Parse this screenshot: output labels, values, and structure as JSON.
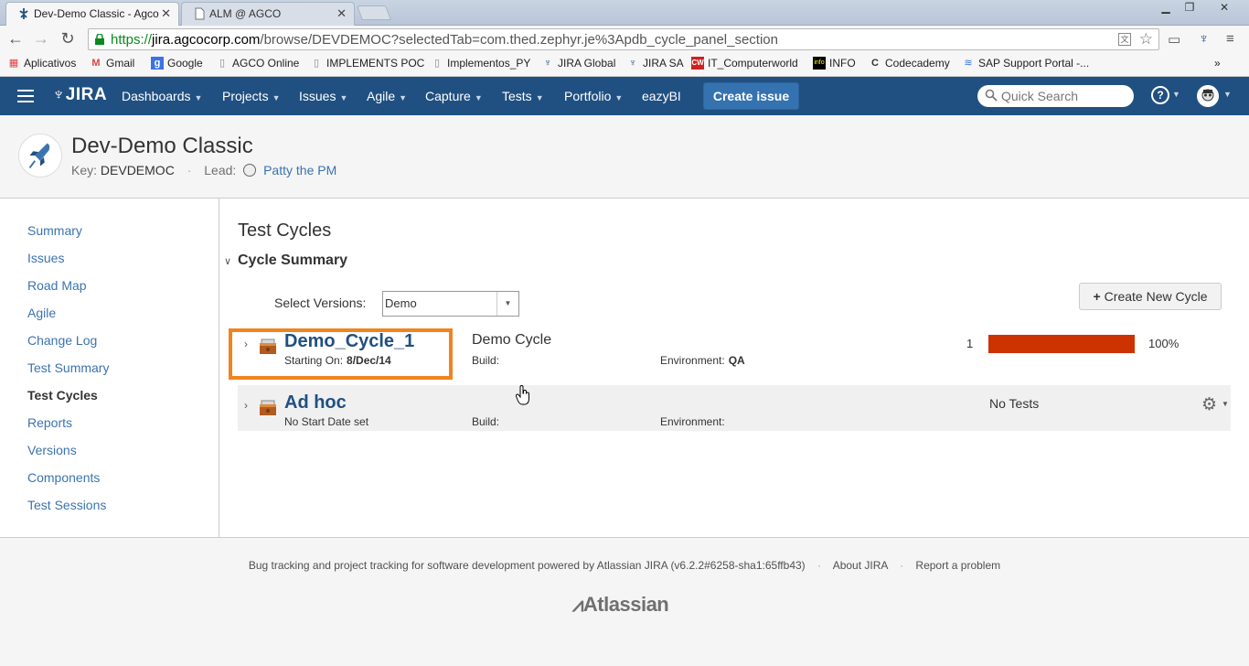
{
  "browser": {
    "tabs": [
      {
        "title": "Dev-Demo Classic - Agco",
        "active": true
      },
      {
        "title": "ALM @ AGCO",
        "active": false
      }
    ],
    "url": {
      "scheme": "https://",
      "host": "jira.agcocorp.com",
      "path": "/browse/DEVDEMOC?selectedTab=com.thed.zephyr.je%3Apdb_cycle_panel_section"
    },
    "bookmarks": [
      "Aplicativos",
      "Gmail",
      "Google",
      "AGCO Online",
      "IMPLEMENTS POC",
      "Implementos_PY",
      "JIRA Global",
      "JIRA SA",
      "IT_Computerworld",
      "INFO",
      "Codecademy",
      "SAP Support Portal -..."
    ]
  },
  "jira_header": {
    "logo": "JIRA",
    "nav": [
      "Dashboards",
      "Projects",
      "Issues",
      "Agile",
      "Capture",
      "Tests",
      "Portfolio",
      "eazyBI"
    ],
    "create_issue": "Create issue",
    "search_placeholder": "Quick Search",
    "help": "?"
  },
  "project": {
    "name": "Dev-Demo Classic",
    "key_label": "Key:",
    "key": "DEVDEMOC",
    "lead_label": "Lead:",
    "lead": "Patty the PM"
  },
  "sidebar": {
    "items": [
      "Summary",
      "Issues",
      "Road Map",
      "Agile",
      "Change Log",
      "Test Summary",
      "Test Cycles",
      "Reports",
      "Versions",
      "Components",
      "Test Sessions"
    ],
    "active": "Test Cycles"
  },
  "main": {
    "title": "Test Cycles",
    "section": "Cycle Summary",
    "select_versions_label": "Select Versions:",
    "selected_version": "Demo",
    "create_cycle_label": "Create New Cycle",
    "cycles": [
      {
        "name": "Demo_Cycle_1",
        "start_label": "Starting On:",
        "start_date": "8/Dec/14",
        "description": "Demo Cycle",
        "build_label": "Build:",
        "build": "",
        "env_label": "Environment:",
        "env": "QA",
        "count": "1",
        "progress_fraction": 1.0,
        "progress_text": "100%",
        "progress_color": "#cc3300"
      },
      {
        "name": "Ad hoc",
        "start_text": "No Start Date set",
        "description": "",
        "build_label": "Build:",
        "build": "",
        "env_label": "Environment:",
        "env": "",
        "status_text": "No Tests"
      }
    ]
  },
  "footer": {
    "text": "Bug tracking and project tracking for software development powered by Atlassian JIRA (v6.2.2#6258-sha1:65ffb43)",
    "about": "About JIRA",
    "report": "Report a problem",
    "logo": "Atlassian"
  },
  "colors": {
    "header_bg": "#205081",
    "link": "#3b73af",
    "highlight": "#f0841e"
  }
}
